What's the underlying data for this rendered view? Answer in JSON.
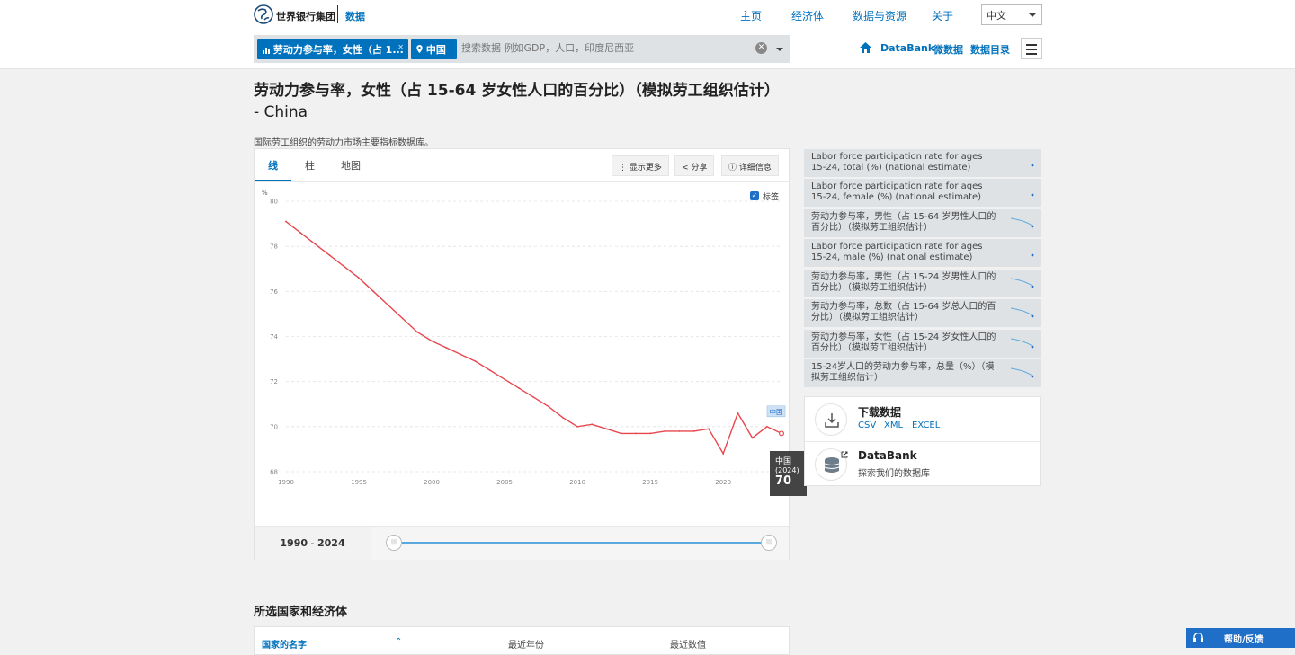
{
  "header": {
    "logo_text": "世界银行集团",
    "logo_section": "数据",
    "nav": [
      "主页",
      "经济体",
      "数据与资源",
      "关于"
    ],
    "language": "中文",
    "search_chip_indicator": "劳动力参与率，女性（占 1...",
    "search_chip_country": "中国",
    "search_placeholder": "搜索数据 例如GDP，人口，印度尼西亚",
    "sub_nav": [
      "DataBank",
      "微数据",
      "数据目录"
    ]
  },
  "page": {
    "title": "劳动力参与率，女性（占 15-64 岁女性人口的百分比）（模拟劳工组织估计）",
    "title_country": "- China",
    "description": "国际劳工组织的劳动力市场主要指标数据库。"
  },
  "chart_card": {
    "tabs": [
      "线",
      "柱",
      "地图"
    ],
    "active_tab": "线",
    "buttons": {
      "more": "显示更多",
      "share": "分享",
      "details": "详细信息"
    },
    "legend_checkbox_label": "标签",
    "series_label": "中国",
    "tooltip": {
      "country": "中国",
      "year": "(2024)",
      "value": "70"
    },
    "range_label_start": "1990",
    "range_label_sep": " - ",
    "range_label_end": "2024"
  },
  "chart_data": {
    "type": "line",
    "title": "",
    "xlabel": "",
    "ylabel": "%",
    "ylim": [
      68,
      80
    ],
    "xlim": [
      1990,
      2024
    ],
    "x_ticks": [
      1990,
      1995,
      2000,
      2005,
      2010,
      2015,
      2020
    ],
    "y_ticks": [
      68,
      70,
      72,
      74,
      76,
      78,
      80
    ],
    "grid": true,
    "series": [
      {
        "name": "中国",
        "color": "#e8474e",
        "x": [
          1990,
          1991,
          1992,
          1993,
          1994,
          1995,
          1996,
          1997,
          1998,
          1999,
          2000,
          2001,
          2002,
          2003,
          2004,
          2005,
          2006,
          2007,
          2008,
          2009,
          2010,
          2011,
          2012,
          2013,
          2014,
          2015,
          2016,
          2017,
          2018,
          2019,
          2020,
          2021,
          2022,
          2023,
          2024
        ],
        "y": [
          79.1,
          78.6,
          78.1,
          77.6,
          77.1,
          76.6,
          76.0,
          75.4,
          74.8,
          74.2,
          73.8,
          73.5,
          73.2,
          72.9,
          72.5,
          72.1,
          71.7,
          71.3,
          70.9,
          70.4,
          70.0,
          70.1,
          69.9,
          69.7,
          69.7,
          69.7,
          69.8,
          69.8,
          69.8,
          69.9,
          68.8,
          70.6,
          69.5,
          70.0,
          69.7
        ]
      }
    ]
  },
  "related": [
    "Labor force participation rate for ages 15-24, total (%) (national estimate)",
    "Labor force participation rate for ages 15-24, female (%) (national estimate)",
    "劳动力参与率，男性（占 15-64 岁男性人口的百分比）（模拟劳工组织估计）",
    "Labor force participation rate for ages 15-24, male (%) (national estimate)",
    "劳动力参与率，男性（占 15-24 岁男性人口的百分比）（模拟劳工组织估计）",
    "劳动力参与率，总数（占 15-64 岁总人口的百分比）（模拟劳工组织估计）",
    "劳动力参与率，女性（占 15-24 岁女性人口的百分比）（模拟劳工组织估计）",
    "15-24岁人口的劳动力参与率，总量（%）（模拟劳工组织估计）"
  ],
  "download": {
    "title": "下载数据",
    "links": [
      "CSV",
      "XML",
      "EXCEL"
    ],
    "databank_title": "DataBank",
    "databank_sub": "探索我们的数据库"
  },
  "countries_section": {
    "title": "所选国家和经济体",
    "columns": [
      "国家的名字",
      "最近年份",
      "最近数值"
    ]
  },
  "help_button": "帮助/反馈",
  "colors": {
    "brand": "#0071bc",
    "line": "#e8474e",
    "slider": "#5aa8de"
  }
}
